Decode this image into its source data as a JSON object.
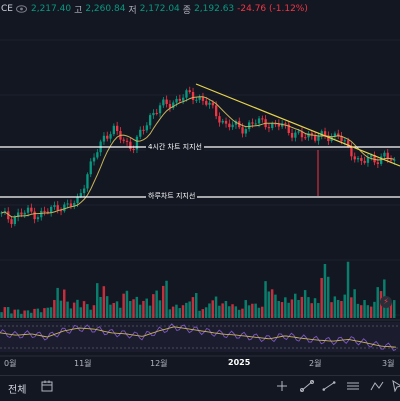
{
  "header": {
    "symbol": "CE",
    "open_value": "2,217.40",
    "high_key": "고",
    "high_value": "2,260.84",
    "low_key": "저",
    "low_value": "2,172.04",
    "close_key": "종",
    "close_value": "2,192.63",
    "change": "-24.76 (-1.12%)"
  },
  "annotations": {
    "support_4h": "4시간 차트 지지선",
    "support_daily": "하루차트 지지선"
  },
  "x_axis": {
    "labels": [
      "0월",
      "11월",
      "12월",
      "2025",
      "2월",
      "3월"
    ]
  },
  "bottom": {
    "all_label": "전체"
  },
  "colors": {
    "up": "#089981",
    "down": "#f23645",
    "ma": "#c8b35a",
    "trendline": "#e8d44d",
    "support": "#ffffff",
    "rsi": "#7e57c2",
    "background": "#131722"
  },
  "icons": [
    "eye-icon",
    "calendar-range-icon",
    "measure-icon",
    "trend-tool-icon",
    "bolt-icon"
  ],
  "chart_data": {
    "type": "candlestick",
    "close_series_estimate": [
      2000,
      1985,
      2005,
      2012,
      2000,
      2015,
      2035,
      2030,
      2050,
      2140,
      2230,
      2310,
      2325,
      2290,
      2260,
      2320,
      2390,
      2420,
      2430,
      2450,
      2465,
      2455,
      2430,
      2390,
      2345,
      2345,
      2335,
      2355,
      2365,
      2340,
      2350,
      2320,
      2300,
      2310,
      2305,
      2295,
      2320,
      2250,
      2215,
      2215,
      2205,
      2240,
      2192
    ],
    "volume_estimate": [
      1.3,
      1.0,
      0.9,
      1.1,
      1.2,
      2.2,
      3.5,
      1.9,
      2.1,
      1.6,
      4.0,
      2.5,
      1.9,
      3.1,
      2.4,
      2.2,
      3.1,
      4.2,
      1.5,
      1.7,
      2.8,
      1.2,
      2.4,
      2.0,
      1.9,
      1.3,
      2.0,
      1.6,
      4.1,
      2.6,
      2.3,
      2.7,
      3.1,
      2.2,
      6.0,
      2.4,
      2.6,
      3.2,
      2.0,
      1.8,
      4.3,
      2.5,
      2.0
    ],
    "support_levels": {
      "support_4h": 2290,
      "support_daily": 2120
    },
    "trendline_points": [
      [
        23,
        2465
      ],
      [
        42,
        2215
      ]
    ],
    "rsi_estimate": [
      52,
      48,
      50,
      45,
      55,
      60,
      58,
      52,
      50,
      46,
      55,
      62,
      58,
      54,
      50,
      48,
      45,
      42,
      47,
      43,
      40,
      38,
      41,
      36,
      30,
      28
    ],
    "x_label_positions": [
      0,
      9,
      17,
      25,
      33,
      41
    ]
  }
}
